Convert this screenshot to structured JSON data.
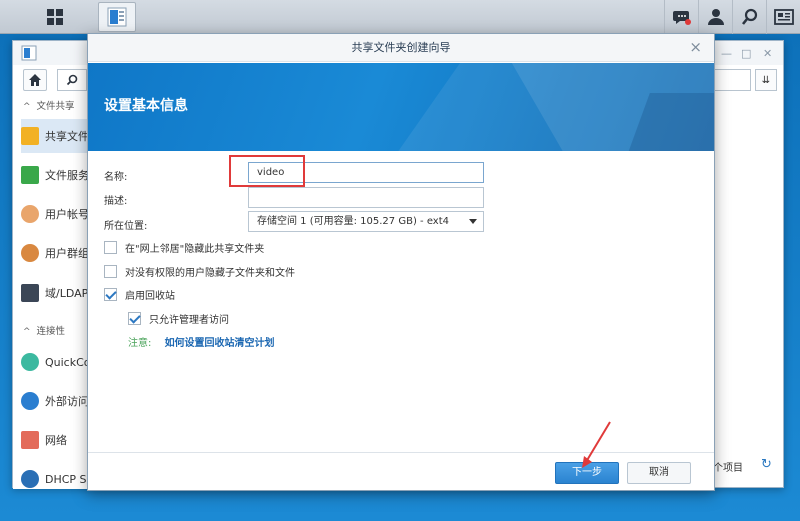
{
  "dialog": {
    "title": "共享文件夹创建向导",
    "close_glyph": "×",
    "banner_title": "设置基本信息",
    "form": {
      "name_label": "名称:",
      "name_value": "video",
      "desc_label": "描述:",
      "desc_value": "",
      "location_label": "所在位置:",
      "location_value": "存储空间 1 (可用容量:  105.27 GB) - ext4"
    },
    "checkboxes": [
      {
        "label": "在\"网上邻居\"隐藏此共享文件夹",
        "checked": false
      },
      {
        "label": "对没有权限的用户隐藏子文件夹和文件",
        "checked": false
      },
      {
        "label": "启用回收站",
        "checked": true
      },
      {
        "label": "只允许管理者访问",
        "checked": true
      }
    ],
    "note_key": "注意:",
    "note_link": "如何设置回收站清空计划",
    "next_label": "下一步",
    "cancel_label": "取消"
  },
  "background_window": {
    "section_file_sharing": "文件共享",
    "section_connectivity": "连接性",
    "sidebar_items": [
      "共享文件",
      "文件服务",
      "用户帐号",
      "用户群组",
      "域/LDAP",
      "QuickConnect",
      "外部访问",
      "网络",
      "DHCP Server"
    ],
    "item_count_text": "个项目",
    "sort_glyph": "⇊"
  },
  "colors": {
    "accent": "#2a83d0",
    "highlight_box": "#e03a3a",
    "banner": "#0f77c7"
  }
}
